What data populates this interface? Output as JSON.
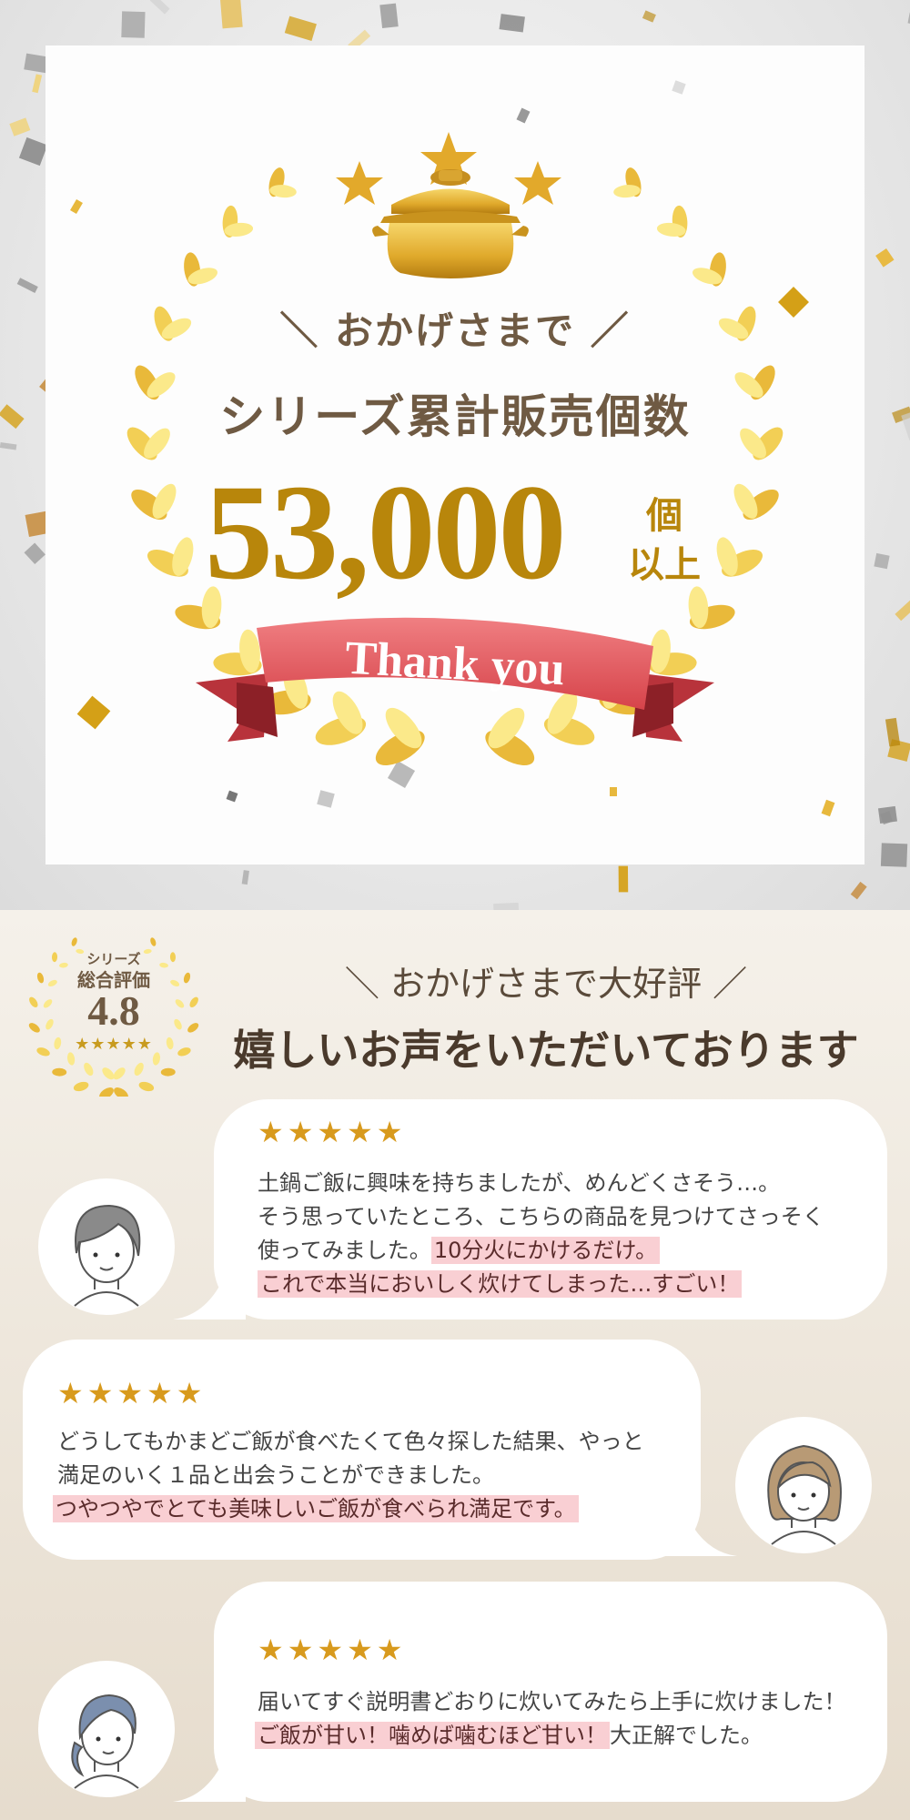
{
  "hero": {
    "subtitle": "＼ おかげさまで ／",
    "title": "シリーズ累計販売個数",
    "count": "53,000",
    "unit_line1": "個",
    "unit_line2": "以上",
    "ribbon": "Thank you",
    "accent_color": "#b8860b",
    "ribbon_color": "#e25a5e"
  },
  "rating_badge": {
    "top": "シリーズ",
    "label": "総合評価",
    "score": "4.8",
    "stars": "★★★★★"
  },
  "reviews_header": {
    "subtitle": "＼ おかげさまで大好評 ／",
    "title": "嬉しいお声をいただいております"
  },
  "reviews": [
    {
      "stars": "★★★★★",
      "line1": "土鍋ご飯に興味を持ちましたが、めんどくさそう…。",
      "line2": "そう思っていたところ、こちらの商品を見つけてさっそく",
      "line3_plain": "使ってみました。",
      "line3_highlight": "10分火にかけるだけ。",
      "line4_highlight": "これで本当においしく炊けてしまった…すごい！",
      "avatar": "woman-short-dark-hair-avatar"
    },
    {
      "stars": "★★★★★",
      "line1": "どうしてもかまどご飯が食べたくて色々探した結果、やっと",
      "line2": "満足のいく１品と出会うことができました。",
      "line3_highlight": "つやつやでとても美味しいご飯が食べられ満足です。",
      "avatar": "woman-brown-bob-hair-avatar"
    },
    {
      "stars": "★★★★★",
      "line1": "届いてすぐ説明書どおりに炊いてみたら上手に炊けました！",
      "line2_highlight": "ご飯が甘い！噛めば噛むほど甘い！",
      "line2_plain": "大正解でした。",
      "avatar": "woman-ponytail-blue-hair-avatar"
    }
  ]
}
